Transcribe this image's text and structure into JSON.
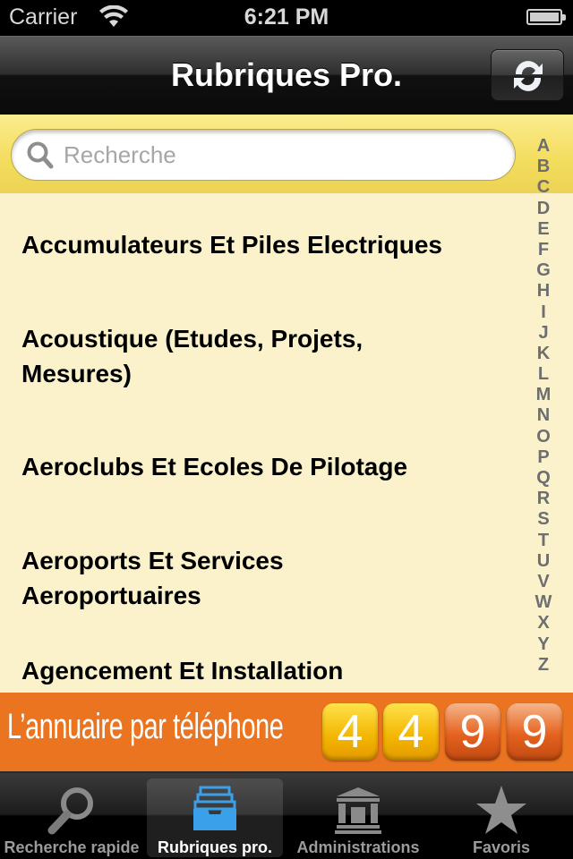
{
  "status_bar": {
    "carrier": "Carrier",
    "time": "6:21 PM"
  },
  "nav": {
    "title": "Rubriques Pro.",
    "refresh_icon": "refresh-icon"
  },
  "search": {
    "placeholder": "Recherche",
    "value": ""
  },
  "list": {
    "items": [
      {
        "label": "Accumulateurs Et Piles Electriques"
      },
      {
        "label": "Acoustique (Etudes, Projets, Mesures)"
      },
      {
        "label": "Aeroclubs Et Ecoles De Pilotage"
      },
      {
        "label": "Aeroports Et Services Aeroportuaires"
      },
      {
        "label": "Agencement Et Installation"
      }
    ]
  },
  "index": [
    "A",
    "B",
    "C",
    "D",
    "E",
    "F",
    "G",
    "H",
    "I",
    "J",
    "K",
    "L",
    "M",
    "N",
    "O",
    "P",
    "Q",
    "R",
    "S",
    "T",
    "U",
    "V",
    "W",
    "X",
    "Y",
    "Z"
  ],
  "banner": {
    "slogan": "L’annuaire par téléphone",
    "digits": [
      "4",
      "4",
      "9",
      "9"
    ],
    "color": "#ea7420"
  },
  "tabs": [
    {
      "label": "Recherche rapide",
      "icon": "magnifier-icon",
      "active": false
    },
    {
      "label": "Rubriques pro.",
      "icon": "inbox-tray-icon",
      "active": true
    },
    {
      "label": "Administrations",
      "icon": "government-building-icon",
      "active": false
    },
    {
      "label": "Favoris",
      "icon": "star-icon",
      "active": false
    }
  ],
  "colors": {
    "list_bg": "#fbf2cc",
    "search_bar": "#f3dd5c",
    "index_text": "#6d6e70",
    "tab_active_icon": "#3aa0ea"
  }
}
